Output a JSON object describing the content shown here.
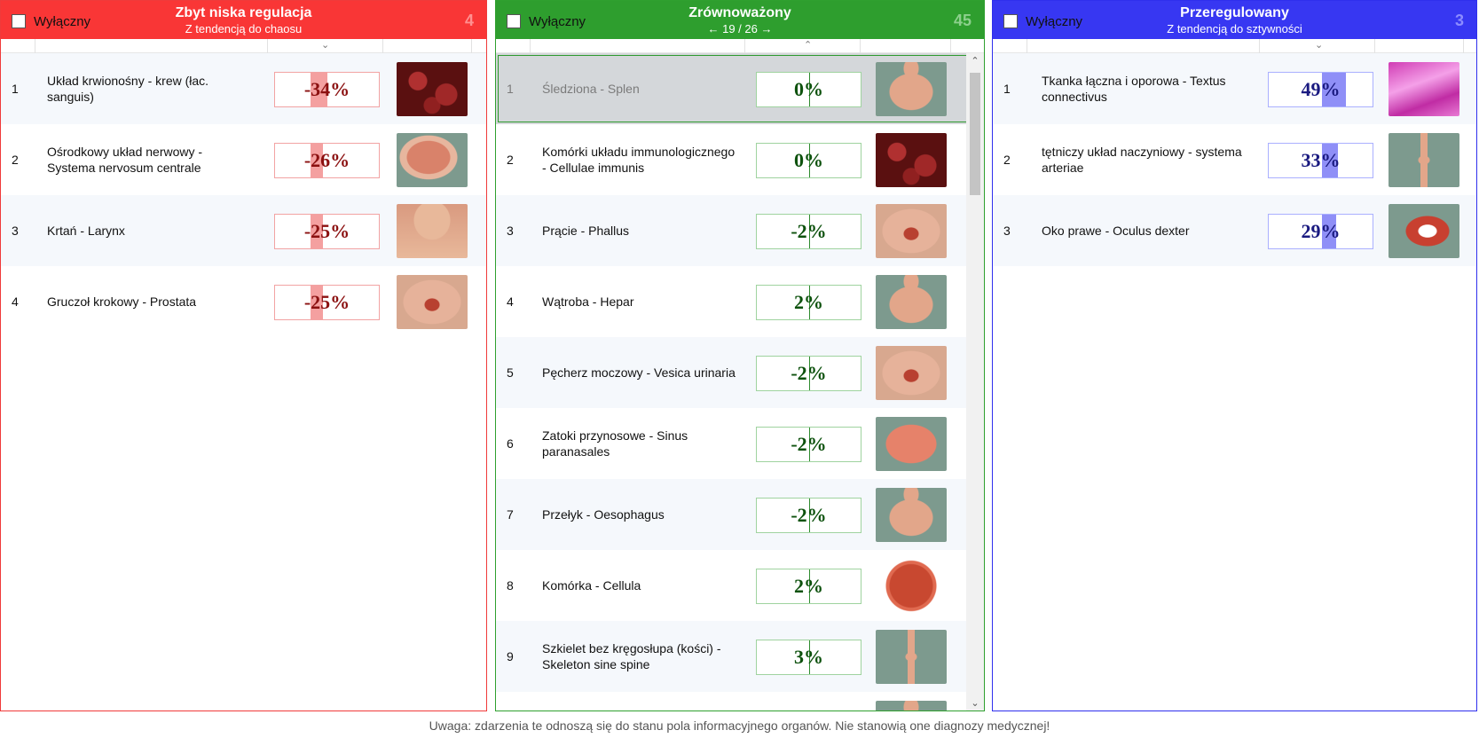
{
  "colors": {
    "red": "#f93636",
    "green": "#2e9e2e",
    "blue": "#3737f2"
  },
  "panels": {
    "red": {
      "exclusive_label": "Wyłączny",
      "title": "Zbyt niska regulacja",
      "subtitle": "Z tendencją do chaosu",
      "count": "4",
      "sort_icon": "chevron-down-icon",
      "rows": [
        {
          "num": "1",
          "name": "Układ krwionośny - krew (łac. sanguis)",
          "pct": "-34%",
          "level": 0.34,
          "thumb": "blood-cells"
        },
        {
          "num": "2",
          "name": "Ośrodkowy układ nerwowy - Systema nervosum centrale",
          "pct": "-26%",
          "level": 0.26,
          "thumb": "brain"
        },
        {
          "num": "3",
          "name": "Krtań - Larynx",
          "pct": "-25%",
          "level": 0.25,
          "thumb": "throat"
        },
        {
          "num": "4",
          "name": "Gruczoł krokowy - Prostata",
          "pct": "-25%",
          "level": 0.25,
          "thumb": "pelvis"
        }
      ]
    },
    "green": {
      "exclusive_label": "Wyłączny",
      "title": "Zrównoważony",
      "subtitle": "← 19 / 26 →",
      "count": "45",
      "sort_icon": "chevron-up-icon",
      "rows": [
        {
          "num": "1",
          "name": "Śledziona - Splen",
          "pct": "0%",
          "thumb": "torso"
        },
        {
          "num": "2",
          "name": "Komórki układu immunologicznego - Cellulae immunis",
          "pct": "0%",
          "thumb": "blood-cells"
        },
        {
          "num": "3",
          "name": "Prącie - Phallus",
          "pct": "-2%",
          "thumb": "pelvis"
        },
        {
          "num": "4",
          "name": "Wątroba - Hepar",
          "pct": "2%",
          "thumb": "torso"
        },
        {
          "num": "5",
          "name": "Pęcherz moczowy - Vesica urinaria",
          "pct": "-2%",
          "thumb": "pelvis"
        },
        {
          "num": "6",
          "name": "Zatoki przynosowe - Sinus paranasales",
          "pct": "-2%",
          "thumb": "face"
        },
        {
          "num": "7",
          "name": "Przełyk - Oesophagus",
          "pct": "-2%",
          "thumb": "torso"
        },
        {
          "num": "8",
          "name": "Komórka - Cellula",
          "pct": "2%",
          "thumb": "cell"
        },
        {
          "num": "9",
          "name": "Szkielet bez kręgosłupa (kości) - Skeleton sine spine",
          "pct": "3%",
          "thumb": "body"
        },
        {
          "num": "",
          "name": "",
          "pct": "",
          "thumb": "torso"
        }
      ]
    },
    "blue": {
      "exclusive_label": "Wyłączny",
      "title": "Przeregulowany",
      "subtitle": "Z tendencją do sztywności",
      "count": "3",
      "sort_icon": "chevron-down-icon",
      "rows": [
        {
          "num": "1",
          "name": "Tkanka łączna i oporowa - Textus connectivus",
          "pct": "49%",
          "level": 0.49,
          "thumb": "tissue"
        },
        {
          "num": "2",
          "name": "tętniczy układ naczyniowy - systema arteriae",
          "pct": "33%",
          "level": 0.33,
          "thumb": "body"
        },
        {
          "num": "3",
          "name": "Oko prawe - Oculus dexter",
          "pct": "29%",
          "level": 0.29,
          "thumb": "eye"
        }
      ]
    }
  },
  "footer": "Uwaga: zdarzenia te odnoszą się do stanu pola informacyjnego organów. Nie stanowią one diagnozy medycznej!"
}
